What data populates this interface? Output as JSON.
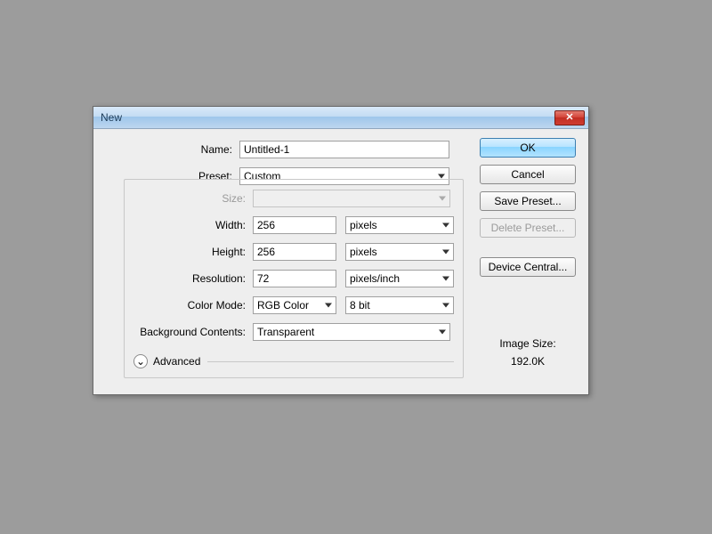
{
  "dialog": {
    "title": "New",
    "name_label": "Name:",
    "name_value": "Untitled-1",
    "preset_label": "Preset:",
    "preset_value": "Custom",
    "size_label": "Size:",
    "size_value": "",
    "width_label": "Width:",
    "width_value": "256",
    "width_unit": "pixels",
    "height_label": "Height:",
    "height_value": "256",
    "height_unit": "pixels",
    "resolution_label": "Resolution:",
    "resolution_value": "72",
    "resolution_unit": "pixels/inch",
    "colormode_label": "Color Mode:",
    "colormode_value": "RGB Color",
    "colormode_depth": "8 bit",
    "bg_label": "Background Contents:",
    "bg_value": "Transparent",
    "advanced_label": "Advanced"
  },
  "buttons": {
    "ok": "OK",
    "cancel": "Cancel",
    "save_preset": "Save Preset...",
    "delete_preset": "Delete Preset...",
    "device_central": "Device Central..."
  },
  "image_size": {
    "label": "Image Size:",
    "value": "192.0K"
  }
}
